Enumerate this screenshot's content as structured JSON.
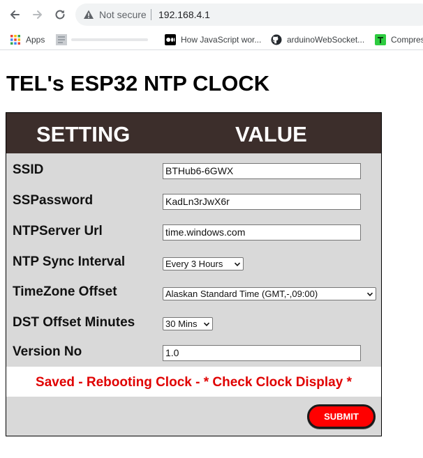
{
  "browser": {
    "security_text": "Not secure",
    "url": "192.168.4.1",
    "bookmarks": [
      {
        "label": "Apps",
        "icon": "apps-grid-icon"
      },
      {
        "label": "",
        "icon": "page-thumbnail-icon"
      },
      {
        "label": "How JavaScript wor...",
        "icon": "medium-icon"
      },
      {
        "label": "arduinoWebSocket...",
        "icon": "github-icon"
      },
      {
        "label": "Compres",
        "icon": "compress-icon"
      }
    ]
  },
  "page": {
    "title": "TEL's ESP32 NTP CLOCK"
  },
  "table": {
    "header_setting": "SETTING",
    "header_value": "VALUE",
    "rows": [
      {
        "label": "SSID",
        "value": "BTHub6-6GWX"
      },
      {
        "label": "SSPassword",
        "value": "KadLn3rJwX6r"
      },
      {
        "label": "NTPServer Url",
        "value": "time.windows.com"
      },
      {
        "label": "NTP Sync Interval",
        "value": "Every 3 Hours"
      },
      {
        "label": "TimeZone Offset",
        "value": "Alaskan Standard Time (GMT,-,09:00)"
      },
      {
        "label": "DST Offset Minutes",
        "value": "30 Mins"
      },
      {
        "label": "Version No",
        "value": "1.0"
      }
    ],
    "status_message": "Saved - Rebooting Clock - * Check Clock Display *",
    "submit_label": "SUBMIT"
  },
  "colors": {
    "header_bg": "#3c2e2b",
    "panel_bg": "#d9d9d9",
    "status_red": "#e00000",
    "submit_red": "#ff0000"
  }
}
